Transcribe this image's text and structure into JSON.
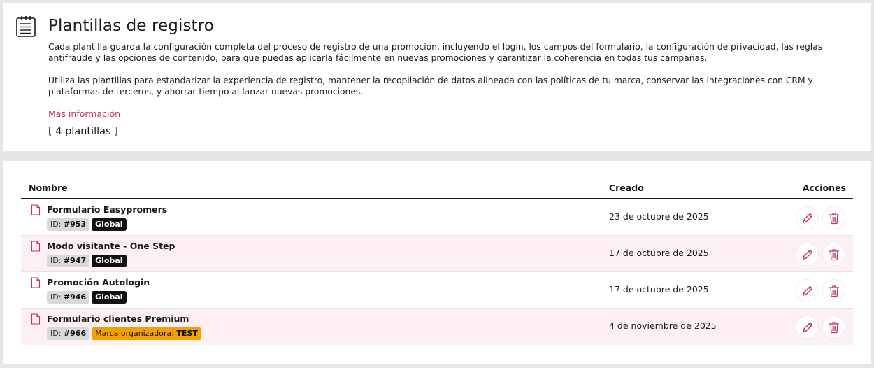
{
  "header": {
    "icon": "list-document-icon",
    "title": "Plantillas de registro",
    "description_1": "Cada plantilla guarda la configuración completa del proceso de registro de una promoción, incluyendo el login, los campos del formulario, la configuración de privacidad, las reglas antifraude y las opciones de contenido, para que puedas aplicarla fácilmente en nuevas promociones y garantizar la coherencia en todas tus campañas.",
    "description_2": "Utiliza las plantillas para estandarizar la experiencia de registro, mantener la recopilación de datos alineada con las políticas de tu marca, conservar las integraciones con CRM y plataformas de terceros, y ahorrar tiempo al lanzar nuevas promociones.",
    "more_link": "Más información",
    "count": "[ 4 plantillas ]"
  },
  "table": {
    "columns": {
      "name": "Nombre",
      "created": "Creado",
      "actions": "Acciones"
    },
    "rows": [
      {
        "title": "Formulario Easypromers",
        "id_label": "ID: ",
        "id": "#953",
        "tag": "Global",
        "date": "23 de octubre de 2025"
      },
      {
        "title": "Modo visitante - One Step",
        "id_label": "ID: ",
        "id": "#947",
        "tag": "Global",
        "date": "17 de octubre de 2025"
      },
      {
        "title": "Promoción Autologin",
        "id_label": "ID: ",
        "id": "#946",
        "tag": "Global",
        "date": "17 de octubre de 2025"
      },
      {
        "title": "Formulario clientes Premium",
        "id_label": "ID: ",
        "id": "#966",
        "tag_label": "Marca organizadora: ",
        "tag": "TEST",
        "date": "4 de noviembre de 2025"
      }
    ]
  },
  "colors": {
    "accent": "#c0306a",
    "row_alt": "#fdf0f3",
    "tag_global": "#111111",
    "tag_brand": "#f5a000"
  },
  "icons": {
    "row": "document-icon",
    "edit": "pencil-icon",
    "delete": "trash-icon"
  }
}
